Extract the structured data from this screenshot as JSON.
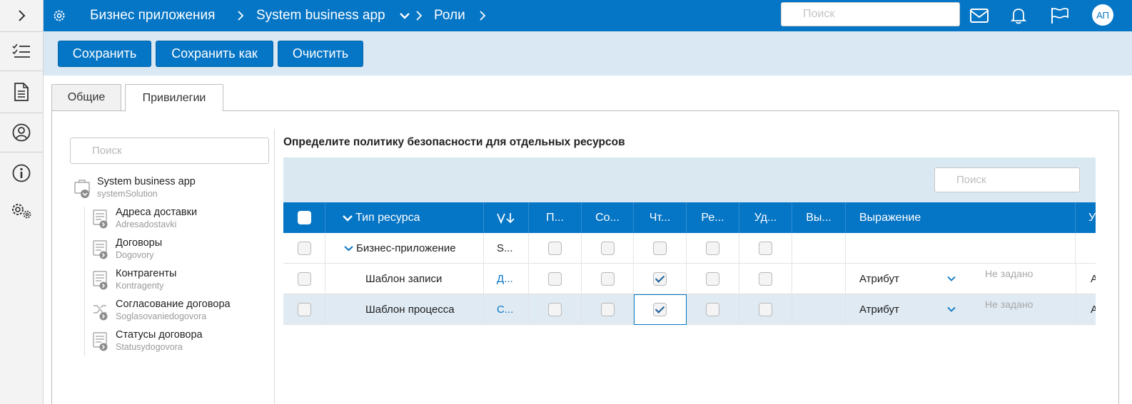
{
  "header": {
    "breadcrumbs": [
      "Бизнес приложения",
      "System business app",
      "Роли"
    ],
    "search_placeholder": "Поиск",
    "avatar_initials": "АП"
  },
  "toolbar": {
    "save": "Сохранить",
    "save_as": "Сохранить как",
    "clear": "Очистить"
  },
  "tabs": [
    "Общие",
    "Привилегии"
  ],
  "tree": {
    "search_placeholder": "Поиск",
    "root": {
      "title": "System business app",
      "sub": "systemSolution"
    },
    "items": [
      {
        "title": "Адреса доставки",
        "sub": "Adresadostavki",
        "icon": "list-icon"
      },
      {
        "title": "Договоры",
        "sub": "Dogovory",
        "icon": "list-icon"
      },
      {
        "title": "Контрагенты",
        "sub": "Kontragenty",
        "icon": "list-icon"
      },
      {
        "title": "Согласование договора",
        "sub": "Soglasovaniedogovora",
        "icon": "shuffle-icon"
      },
      {
        "title": "Статусы договора",
        "sub": "Statusydogovora",
        "icon": "list-icon"
      }
    ]
  },
  "main": {
    "title": "Определите политику безопасности для отдельных ресурсов",
    "search_placeholder": "Поиск",
    "columns": [
      "Тип ресурса",
      "П...",
      "Со...",
      "Чт...",
      "Ре...",
      "Уд...",
      "Вы...",
      "Выражение",
      "У"
    ],
    "rows": [
      {
        "type": "Бизнес-приложение",
        "name": "S...",
        "expression": "",
        "value": "",
        "extra": "",
        "checks": [
          false,
          false,
          false,
          false,
          false
        ],
        "checked": false
      },
      {
        "type": "Шаблон записи",
        "name": "Д...",
        "expression": "Атрибут",
        "value": "Не задано",
        "extra": "А",
        "checks": [
          false,
          false,
          true,
          false,
          false
        ],
        "checked": false
      },
      {
        "type": "Шаблон процесса",
        "name": "С...",
        "expression": "Атрибут",
        "value": "Не задано",
        "extra": "А",
        "checks": [
          false,
          false,
          true,
          false,
          false
        ],
        "checked": false
      }
    ]
  },
  "colors": {
    "primary": "#0575c5",
    "toolbar_bg": "#d9e8f2",
    "selected_row": "#dfeaf3"
  }
}
